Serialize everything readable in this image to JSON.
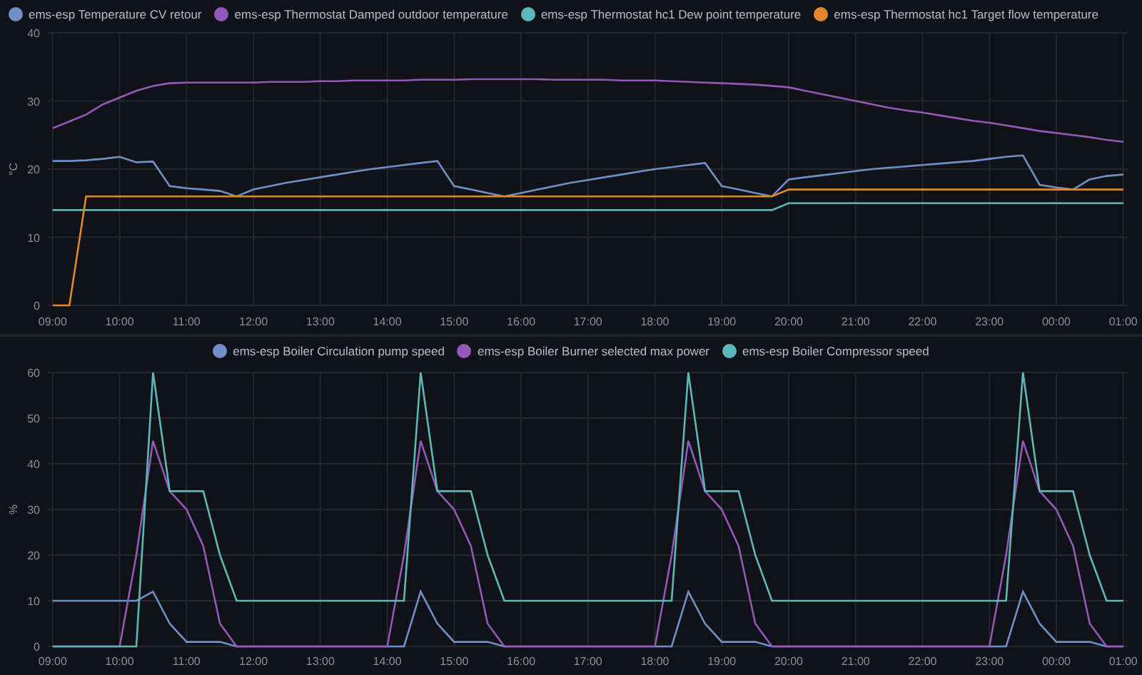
{
  "charts": [
    {
      "chart_data": {
        "type": "line",
        "ylabel": "°C",
        "grid": true,
        "xlim": [
          "--01-01T08:55",
          "--01-02T01:04"
        ],
        "ylim": [
          0,
          40
        ],
        "yticks": [
          0,
          10,
          20,
          30,
          40
        ],
        "xticks": [
          {
            "value": "--01-01T09:00",
            "label": "09:00"
          },
          {
            "value": "--01-01T10:00",
            "label": "10:00"
          },
          {
            "value": "--01-01T11:00",
            "label": "11:00"
          },
          {
            "value": "--01-01T12:00",
            "label": "12:00"
          },
          {
            "value": "--01-01T13:00",
            "label": "13:00"
          },
          {
            "value": "--01-01T14:00",
            "label": "14:00"
          },
          {
            "value": "--01-01T15:00",
            "label": "15:00"
          },
          {
            "value": "--01-01T16:00",
            "label": "16:00"
          },
          {
            "value": "--01-01T17:00",
            "label": "17:00"
          },
          {
            "value": "--01-01T18:00",
            "label": "18:00"
          },
          {
            "value": "--01-01T19:00",
            "label": "19:00"
          },
          {
            "value": "--01-01T20:00",
            "label": "20:00"
          },
          {
            "value": "--01-01T21:00",
            "label": "21:00"
          },
          {
            "value": "--01-01T22:00",
            "label": "22:00"
          },
          {
            "value": "--01-01T23:00",
            "label": "23:00"
          },
          {
            "value": "--01-02T00:00",
            "label": "00:00"
          },
          {
            "value": "--01-02T01:00",
            "label": "01:00"
          }
        ],
        "x": [
          "--01-01T09:00",
          "--01-01T09:15",
          "--01-01T09:30",
          "--01-01T09:45",
          "--01-01T10:00",
          "--01-01T10:15",
          "--01-01T10:30",
          "--01-01T10:45",
          "--01-01T11:00",
          "--01-01T11:15",
          "--01-01T11:30",
          "--01-01T11:45",
          "--01-01T12:00",
          "--01-01T12:15",
          "--01-01T12:30",
          "--01-01T12:45",
          "--01-01T13:00",
          "--01-01T13:15",
          "--01-01T13:30",
          "--01-01T13:45",
          "--01-01T14:00",
          "--01-01T14:15",
          "--01-01T14:30",
          "--01-01T14:45",
          "--01-01T15:00",
          "--01-01T15:15",
          "--01-01T15:30",
          "--01-01T15:45",
          "--01-01T16:00",
          "--01-01T16:15",
          "--01-01T16:30",
          "--01-01T16:45",
          "--01-01T17:00",
          "--01-01T17:15",
          "--01-01T17:30",
          "--01-01T17:45",
          "--01-01T18:00",
          "--01-01T18:15",
          "--01-01T18:30",
          "--01-01T18:45",
          "--01-01T19:00",
          "--01-01T19:15",
          "--01-01T19:30",
          "--01-01T19:45",
          "--01-01T20:00",
          "--01-01T20:15",
          "--01-01T20:30",
          "--01-01T20:45",
          "--01-01T21:00",
          "--01-01T21:15",
          "--01-01T21:30",
          "--01-01T21:45",
          "--01-01T22:00",
          "--01-01T22:15",
          "--01-01T22:30",
          "--01-01T22:45",
          "--01-01T23:00",
          "--01-01T23:15",
          "--01-01T23:30",
          "--01-01T23:45",
          "--01-02T00:00",
          "--01-02T00:15",
          "--01-02T00:30",
          "--01-02T00:45",
          "--01-02T01:00"
        ],
        "series": [
          {
            "name": "ems-esp Temperature CV retour",
            "color": "#6f90c8",
            "values": [
              21.2,
              21.2,
              21.3,
              21.5,
              21.8,
              21,
              21.1,
              17.5,
              17.2,
              17,
              16.8,
              16,
              17,
              17.5,
              18,
              18.4,
              18.8,
              19.2,
              19.6,
              20,
              20.3,
              20.6,
              20.9,
              21.2,
              17.5,
              17,
              16.5,
              16,
              16.5,
              17,
              17.5,
              18,
              18.4,
              18.8,
              19.2,
              19.6,
              20,
              20.3,
              20.6,
              20.9,
              17.5,
              17,
              16.5,
              16,
              18.5,
              18.8,
              19.1,
              19.4,
              19.7,
              20,
              20.2,
              20.4,
              20.6,
              20.8,
              21,
              21.2,
              21.5,
              21.8,
              22,
              17.7,
              17.3,
              17,
              18.5,
              19,
              19.2
            ]
          },
          {
            "name": "ems-esp Thermostat Damped outdoor temperature",
            "color": "#9259b8",
            "values": [
              26,
              27,
              28,
              29.5,
              30.5,
              31.5,
              32.2,
              32.6,
              32.7,
              32.7,
              32.7,
              32.7,
              32.7,
              32.8,
              32.8,
              32.8,
              32.9,
              32.9,
              33,
              33,
              33,
              33,
              33.1,
              33.1,
              33.1,
              33.2,
              33.2,
              33.2,
              33.2,
              33.2,
              33.1,
              33.1,
              33.1,
              33.1,
              33,
              33,
              33,
              32.9,
              32.8,
              32.7,
              32.6,
              32.5,
              32.4,
              32.2,
              32,
              31.5,
              31,
              30.5,
              30,
              29.5,
              29,
              28.6,
              28.3,
              27.9,
              27.5,
              27.1,
              26.8,
              26.4,
              26,
              25.6,
              25.3,
              25,
              24.7,
              24.3,
              24
            ]
          },
          {
            "name": "ems-esp Thermostat hc1 Dew point temperature",
            "color": "#5ab8b8",
            "values": [
              14,
              14,
              14,
              14,
              14,
              14,
              14,
              14,
              14,
              14,
              14,
              14,
              14,
              14,
              14,
              14,
              14,
              14,
              14,
              14,
              14,
              14,
              14,
              14,
              14,
              14,
              14,
              14,
              14,
              14,
              14,
              14,
              14,
              14,
              14,
              14,
              14,
              14,
              14,
              14,
              14,
              14,
              14,
              14,
              15,
              15,
              15,
              15,
              15,
              15,
              15,
              15,
              15,
              15,
              15,
              15,
              15,
              15,
              15,
              15,
              15,
              15,
              15,
              15,
              15
            ]
          },
          {
            "name": "ems-esp Thermostat hc1 Target flow temperature",
            "color": "#e0892a",
            "values": [
              0,
              0,
              16,
              16,
              16,
              16,
              16,
              16,
              16,
              16,
              16,
              16,
              16,
              16,
              16,
              16,
              16,
              16,
              16,
              16,
              16,
              16,
              16,
              16,
              16,
              16,
              16,
              16,
              16,
              16,
              16,
              16,
              16,
              16,
              16,
              16,
              16,
              16,
              16,
              16,
              16,
              16,
              16,
              16,
              17,
              17,
              17,
              17,
              17,
              17,
              17,
              17,
              17,
              17,
              17,
              17,
              17,
              17,
              17,
              17,
              17,
              17,
              17,
              17,
              17
            ]
          }
        ]
      }
    },
    {
      "chart_data": {
        "type": "line",
        "ylabel": "%",
        "grid": true,
        "xlim": [
          "--01-01T08:55",
          "--01-02T01:04"
        ],
        "ylim": [
          0,
          60
        ],
        "yticks": [
          0,
          10,
          20,
          30,
          40,
          50,
          60
        ],
        "xticks": [
          {
            "value": "--01-01T09:00",
            "label": "09:00"
          },
          {
            "value": "--01-01T10:00",
            "label": "10:00"
          },
          {
            "value": "--01-01T11:00",
            "label": "11:00"
          },
          {
            "value": "--01-01T12:00",
            "label": "12:00"
          },
          {
            "value": "--01-01T13:00",
            "label": "13:00"
          },
          {
            "value": "--01-01T14:00",
            "label": "14:00"
          },
          {
            "value": "--01-01T15:00",
            "label": "15:00"
          },
          {
            "value": "--01-01T16:00",
            "label": "16:00"
          },
          {
            "value": "--01-01T17:00",
            "label": "17:00"
          },
          {
            "value": "--01-01T18:00",
            "label": "18:00"
          },
          {
            "value": "--01-01T19:00",
            "label": "19:00"
          },
          {
            "value": "--01-01T20:00",
            "label": "20:00"
          },
          {
            "value": "--01-01T21:00",
            "label": "21:00"
          },
          {
            "value": "--01-01T22:00",
            "label": "22:00"
          },
          {
            "value": "--01-01T23:00",
            "label": "23:00"
          },
          {
            "value": "--01-02T00:00",
            "label": "00:00"
          },
          {
            "value": "--01-02T01:00",
            "label": "01:00"
          }
        ],
        "x": [
          "--01-01T09:00",
          "--01-01T09:15",
          "--01-01T09:30",
          "--01-01T09:45",
          "--01-01T10:00",
          "--01-01T10:15",
          "--01-01T10:30",
          "--01-01T10:45",
          "--01-01T11:00",
          "--01-01T11:15",
          "--01-01T11:30",
          "--01-01T11:45",
          "--01-01T12:00",
          "--01-01T12:15",
          "--01-01T12:30",
          "--01-01T12:45",
          "--01-01T13:00",
          "--01-01T13:15",
          "--01-01T13:30",
          "--01-01T13:45",
          "--01-01T14:00",
          "--01-01T14:15",
          "--01-01T14:30",
          "--01-01T14:45",
          "--01-01T15:00",
          "--01-01T15:15",
          "--01-01T15:30",
          "--01-01T15:45",
          "--01-01T16:00",
          "--01-01T16:15",
          "--01-01T16:30",
          "--01-01T16:45",
          "--01-01T17:00",
          "--01-01T17:15",
          "--01-01T17:30",
          "--01-01T17:45",
          "--01-01T18:00",
          "--01-01T18:15",
          "--01-01T18:30",
          "--01-01T18:45",
          "--01-01T19:00",
          "--01-01T19:15",
          "--01-01T19:30",
          "--01-01T19:45",
          "--01-01T20:00",
          "--01-01T20:15",
          "--01-01T20:30",
          "--01-01T20:45",
          "--01-01T21:00",
          "--01-01T21:15",
          "--01-01T21:30",
          "--01-01T21:45",
          "--01-01T22:00",
          "--01-01T22:15",
          "--01-01T22:30",
          "--01-01T22:45",
          "--01-01T23:00",
          "--01-01T23:15",
          "--01-01T23:30",
          "--01-01T23:45",
          "--01-02T00:00",
          "--01-02T00:15",
          "--01-02T00:30",
          "--01-02T00:45",
          "--01-02T01:00"
        ],
        "series": [
          {
            "name": "ems-esp Boiler Circulation pump speed",
            "color": "#6f90c8",
            "values": [
              10,
              10,
              10,
              10,
              10,
              10,
              12,
              5,
              1,
              1,
              1,
              0,
              0,
              0,
              0,
              0,
              0,
              0,
              0,
              0,
              0,
              0,
              12,
              5,
              1,
              1,
              1,
              0,
              0,
              0,
              0,
              0,
              0,
              0,
              0,
              0,
              0,
              0,
              12,
              5,
              1,
              1,
              1,
              0,
              0,
              0,
              0,
              0,
              0,
              0,
              0,
              0,
              0,
              0,
              0,
              0,
              0,
              0,
              12,
              5,
              1,
              1,
              1,
              0,
              0
            ]
          },
          {
            "name": "ems-esp Boiler Burner selected max power",
            "color": "#9259b8",
            "values": [
              0,
              0,
              0,
              0,
              0,
              20,
              45,
              34,
              30,
              22,
              5,
              0,
              0,
              0,
              0,
              0,
              0,
              0,
              0,
              0,
              0,
              20,
              45,
              34,
              30,
              22,
              5,
              0,
              0,
              0,
              0,
              0,
              0,
              0,
              0,
              0,
              0,
              20,
              45,
              34,
              30,
              22,
              5,
              0,
              0,
              0,
              0,
              0,
              0,
              0,
              0,
              0,
              0,
              0,
              0,
              0,
              0,
              20,
              45,
              34,
              30,
              22,
              5,
              0,
              0
            ]
          },
          {
            "name": "ems-esp Boiler Compressor speed",
            "color": "#5ab8b8",
            "values": [
              0,
              0,
              0,
              0,
              0,
              0,
              60,
              34,
              34,
              34,
              20,
              10,
              10,
              10,
              10,
              10,
              10,
              10,
              10,
              10,
              10,
              10,
              60,
              34,
              34,
              34,
              20,
              10,
              10,
              10,
              10,
              10,
              10,
              10,
              10,
              10,
              10,
              10,
              60,
              34,
              34,
              34,
              20,
              10,
              10,
              10,
              10,
              10,
              10,
              10,
              10,
              10,
              10,
              10,
              10,
              10,
              10,
              10,
              60,
              34,
              34,
              34,
              20,
              10,
              10
            ]
          }
        ]
      }
    }
  ]
}
